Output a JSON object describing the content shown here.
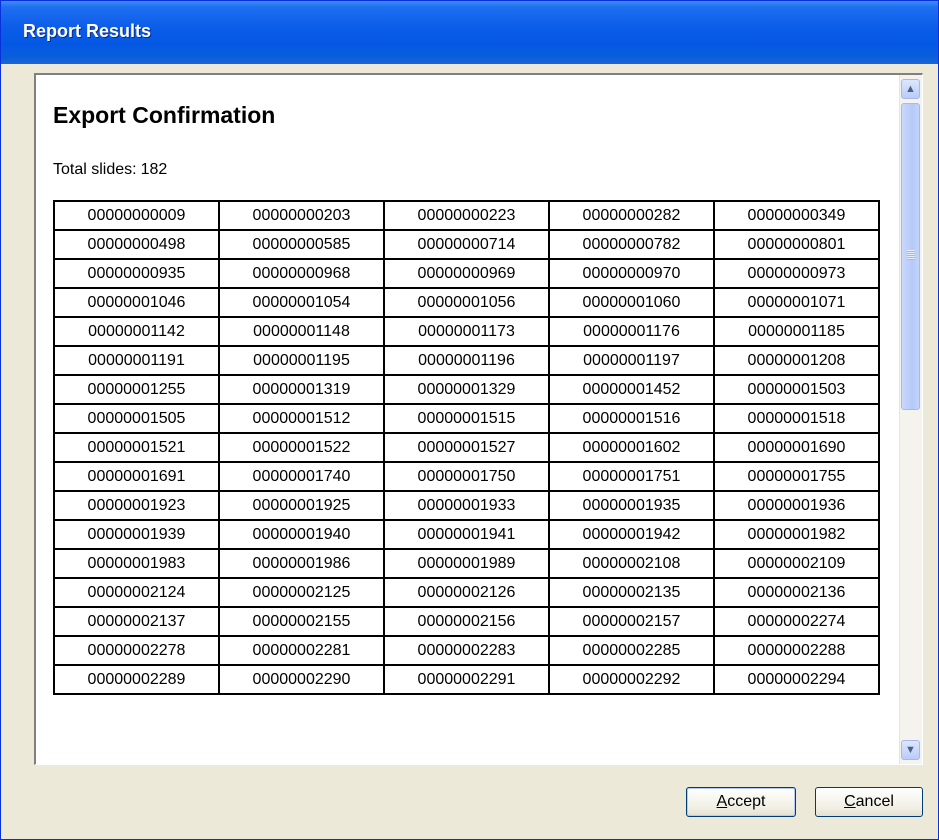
{
  "window": {
    "title": "Report Results"
  },
  "dialog": {
    "heading": "Export Confirmation",
    "total_label": "Total slides:",
    "total_value": "182"
  },
  "table": {
    "rows": [
      [
        "00000000009",
        "00000000203",
        "00000000223",
        "00000000282",
        "00000000349"
      ],
      [
        "00000000498",
        "00000000585",
        "00000000714",
        "00000000782",
        "00000000801"
      ],
      [
        "00000000935",
        "00000000968",
        "00000000969",
        "00000000970",
        "00000000973"
      ],
      [
        "00000001046",
        "00000001054",
        "00000001056",
        "00000001060",
        "00000001071"
      ],
      [
        "00000001142",
        "00000001148",
        "00000001173",
        "00000001176",
        "00000001185"
      ],
      [
        "00000001191",
        "00000001195",
        "00000001196",
        "00000001197",
        "00000001208"
      ],
      [
        "00000001255",
        "00000001319",
        "00000001329",
        "00000001452",
        "00000001503"
      ],
      [
        "00000001505",
        "00000001512",
        "00000001515",
        "00000001516",
        "00000001518"
      ],
      [
        "00000001521",
        "00000001522",
        "00000001527",
        "00000001602",
        "00000001690"
      ],
      [
        "00000001691",
        "00000001740",
        "00000001750",
        "00000001751",
        "00000001755"
      ],
      [
        "00000001923",
        "00000001925",
        "00000001933",
        "00000001935",
        "00000001936"
      ],
      [
        "00000001939",
        "00000001940",
        "00000001941",
        "00000001942",
        "00000001982"
      ],
      [
        "00000001983",
        "00000001986",
        "00000001989",
        "00000002108",
        "00000002109"
      ],
      [
        "00000002124",
        "00000002125",
        "00000002126",
        "00000002135",
        "00000002136"
      ],
      [
        "00000002137",
        "00000002155",
        "00000002156",
        "00000002157",
        "00000002274"
      ],
      [
        "00000002278",
        "00000002281",
        "00000002283",
        "00000002285",
        "00000002288"
      ],
      [
        "00000002289",
        "00000002290",
        "00000002291",
        "00000002292",
        "00000002294"
      ]
    ]
  },
  "buttons": {
    "accept_mnemonic": "A",
    "accept_rest": "ccept",
    "cancel_mnemonic": "C",
    "cancel_rest": "ancel"
  },
  "scrollbar": {
    "up_icon": "scroll-up-arrow-icon",
    "down_icon": "scroll-down-arrow-icon",
    "up_glyph": "▲",
    "down_glyph": "▼"
  },
  "colors": {
    "titlebar": "#0a5ce8",
    "window_face": "#ece9d8",
    "button_border": "#003c74"
  }
}
